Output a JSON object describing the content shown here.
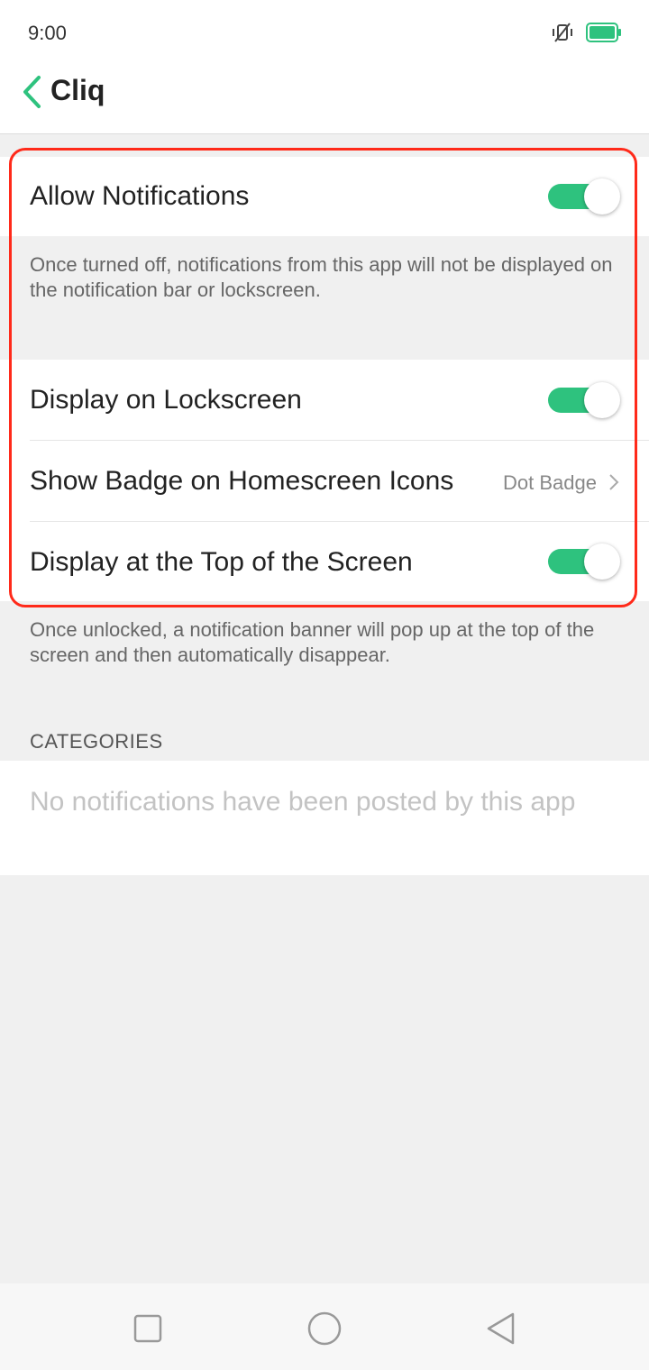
{
  "status_bar": {
    "time": "9:00",
    "icons": [
      "mute-vibrate-icon",
      "battery-icon"
    ],
    "battery_color": "#2ec27e"
  },
  "header": {
    "title": "Cliq",
    "back_icon": "chevron-left-icon",
    "accent_color": "#2ec27e"
  },
  "settings": {
    "allow_notifications": {
      "label": "Allow Notifications",
      "enabled": true
    },
    "allow_note": "Once turned off, notifications from this app will not be displayed on the notification bar or lockscreen.",
    "display_lockscreen": {
      "label": "Display on Lockscreen",
      "enabled": true
    },
    "show_badge": {
      "label": "Show Badge on Homescreen Icons",
      "value": "Dot Badge"
    },
    "display_top": {
      "label": "Display at the Top of the Screen",
      "enabled": true
    },
    "top_note": "Once unlocked, a notification banner will pop up at the top of the screen and then automatically disappear."
  },
  "categories": {
    "header": "CATEGORIES",
    "empty_text": "No notifications have been posted by this app"
  },
  "nav_bar": {
    "buttons": [
      "recents-square-icon",
      "home-circle-icon",
      "back-triangle-icon"
    ]
  },
  "highlight_color": "#ff2a1a"
}
